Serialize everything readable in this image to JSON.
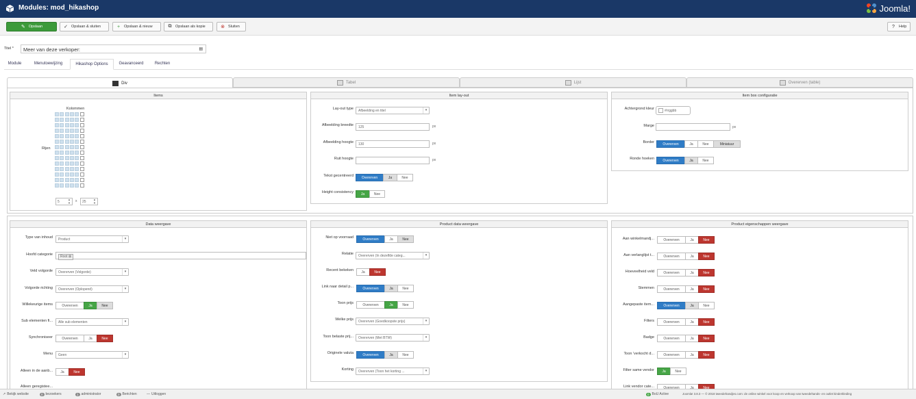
{
  "header": {
    "title": "Modules: mod_hikashop",
    "logo": "Joomla!"
  },
  "toolbar": {
    "save": "Opslaan",
    "save_close": "Opslaan & sluiten",
    "save_new": "Opslaan & nieuw",
    "save_copy": "Opslaan als kopie",
    "close": "Sluiten",
    "help": "Help"
  },
  "title_field": {
    "label": "Titel *",
    "value": "Meer van deze verkoper:"
  },
  "tabs": [
    "Module",
    "Menutoewijzing",
    "Hikashop Options",
    "Geavanceerd",
    "Rechten"
  ],
  "subtabs": [
    "Div",
    "Tabel",
    "Lijst",
    "Overerven (table)"
  ],
  "items_panel": {
    "title": "Items",
    "columns_label": "Kolommen",
    "rows_label": "Rijen",
    "columns_value": "5",
    "times": "x",
    "rows_value": "25"
  },
  "layout_panel": {
    "title": "Item lay-out",
    "layout_type_label": "Lay-out type",
    "layout_type_value": "Afbeelding en titel",
    "img_width_label": "Afbeelding breedte",
    "img_width_value": "125",
    "img_height_label": "Afbeelding hoogte",
    "img_height_value": "130",
    "pane_height_label": "Ruit hoogte",
    "pane_height_value": "",
    "unit": "px",
    "text_center_label": "Tekst gecentreerd",
    "height_consistency_label": "Height consistency"
  },
  "itembox_panel": {
    "title": "Item box configuratie",
    "bg_color_label": "Achtergrond kleur",
    "bg_color_placeholder": "#rrggbb",
    "margin_label": "Marge",
    "unit": "px",
    "border_label": "Border",
    "rounded_label": "Ronde hoeken",
    "miniature": "Miniatuur"
  },
  "opts": {
    "inherit": "Overerven",
    "yes": "Ja",
    "no": "Nee"
  },
  "data_panel": {
    "title": "Data weergave",
    "content_type_label": "Type van inhoud",
    "content_type_value": "Product",
    "main_cat_label": "Hoofd categorie",
    "main_cat_tag": "Root",
    "order_field_label": "Veld volgorde",
    "order_field_value": "Overerven (Volgorde)",
    "order_dir_label": "Volgorde richting",
    "order_dir_value": "Overerven (Oplopend)",
    "random_label": "Willekeurige items",
    "sub_label": "Sub elementen fi...",
    "sub_value": "Alle sub elementen",
    "sync_label": "Synchroniseer",
    "menu_label": "Menu",
    "menu_value": "Geen",
    "only_offer_label": "Alleen in de aanb...",
    "only_reg_label": "Alleen geregistee..."
  },
  "product_panel": {
    "title": "Product data weergave",
    "out_of_stock_label": "Niet op voorraad",
    "relation_label": "Relatie",
    "relation_value": "Overerven (In dezelfde categ...",
    "recent_label": "Recent bekeken",
    "link_label": "Link naar detail p...",
    "show_price_label": "Toon prijs",
    "which_price_label": "Welke prijs",
    "which_price_value": "Overerven (Goedkoopste prijs)",
    "taxed_label": "Toon belaste prij...",
    "taxed_value": "Overerven (Met BTW)",
    "orig_currency_label": "Originele valuta",
    "discount_label": "Korting",
    "discount_value": "Overerven (Toon het korting ..."
  },
  "props_panel": {
    "title": "Product eigenschappen weergave",
    "rows": [
      "Aan winkelmandj...",
      "Aan verlanglijst t...",
      "Hoeveelheid veld",
      "Stemmen",
      "Aangepaste item...",
      "Filters",
      "Badge",
      "Toon 'verkocht d...",
      "Filter same vendor",
      "Link vendor cate..."
    ]
  },
  "statusbar": {
    "view_site": "Bekijk website",
    "visitors_count": "0",
    "visitors": "bezoekers",
    "admin_count": "1",
    "admin": "administrator",
    "messages_count": "0",
    "messages": "Berichten",
    "logout": "Uitloggen",
    "bou_count": "0",
    "bou": "BoU Active",
    "footer": "Joomla! 3.8.3 — © 2018 tweedehandjes.com: de online winkel voor koop en verkoop van tweedehands- en outlet kinderkleding"
  }
}
